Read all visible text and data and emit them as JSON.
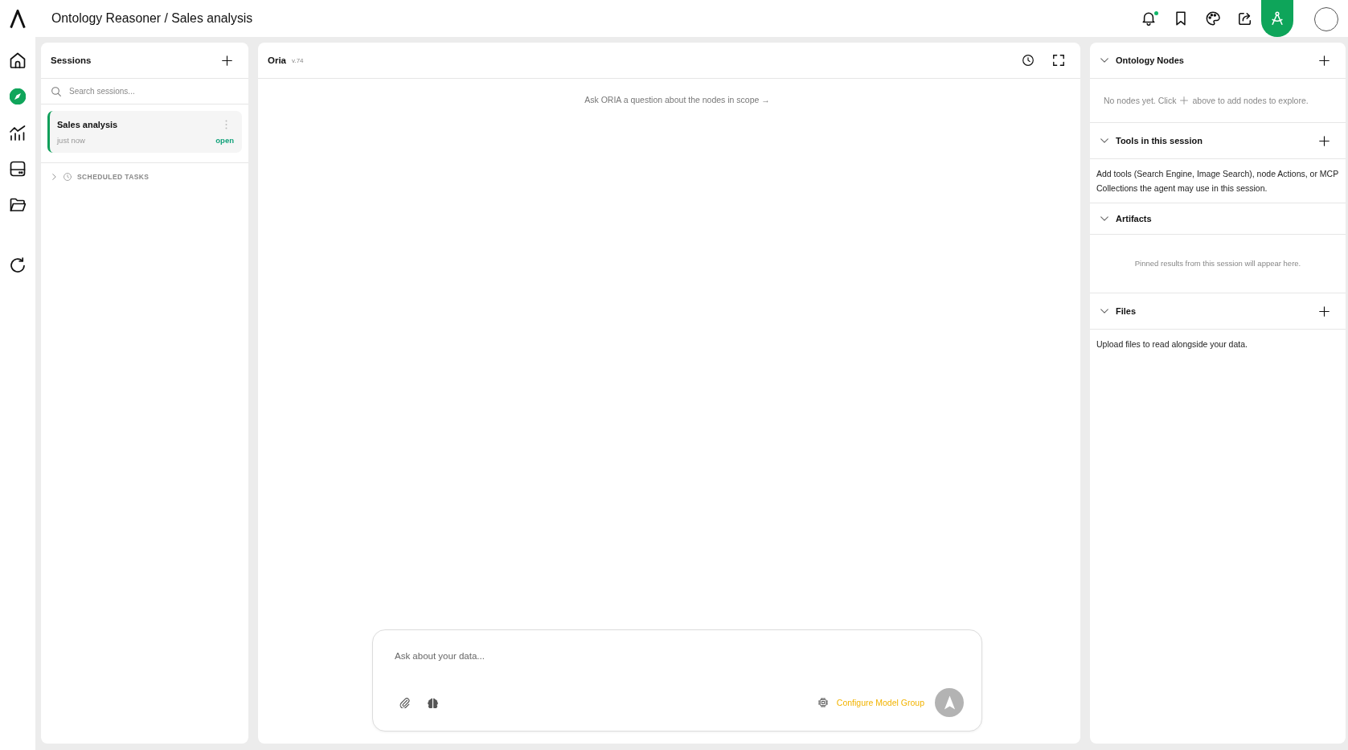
{
  "header": {
    "breadcrumb": "Ontology Reasoner / Sales analysis"
  },
  "top_actions": [
    {
      "kind": "bell",
      "unread": true,
      "selected": false
    },
    {
      "kind": "bookmark",
      "unread": false,
      "selected": false
    },
    {
      "kind": "palette",
      "unread": false,
      "selected": false
    },
    {
      "kind": "share",
      "unread": false,
      "selected": false
    },
    {
      "kind": "compass",
      "unread": false,
      "selected": true
    }
  ],
  "nav": [
    {
      "kind": "home",
      "selected": false
    },
    {
      "kind": "explore",
      "selected": true
    },
    {
      "kind": "chart",
      "selected": false
    },
    {
      "kind": "storage",
      "selected": false
    },
    {
      "kind": "folder",
      "selected": false
    }
  ],
  "sessions": {
    "title": "Sessions",
    "search": {
      "placeholder": "Search sessions..."
    },
    "items": [
      {
        "name": "Sales analysis",
        "time": "just now",
        "status": "open",
        "selected": true
      }
    ],
    "scheduled_tasks": {
      "label": "SCHEDULED TASKS",
      "expanded": false
    }
  },
  "chat": {
    "title": "Oria",
    "version": "v.74",
    "hint": "Ask ORIA a question about the nodes in scope →",
    "composer": {
      "placeholder": "Ask about your data...",
      "model_link": "Configure Model Group"
    }
  },
  "inspector": {
    "sections": [
      {
        "title": "Ontology Nodes",
        "expanded": true,
        "can_add": true,
        "body": {
          "kind": "inline_add_hint",
          "before": "No nodes yet. Click",
          "after": "above to add nodes to explore."
        }
      },
      {
        "title": "Tools in this session",
        "expanded": true,
        "can_add": true,
        "body": {
          "kind": "text",
          "text": "Add tools (Search Engine, Image Search), node Actions, or MCP Collections the agent may use in this session."
        }
      },
      {
        "title": "Artifacts",
        "expanded": true,
        "can_add": false,
        "body": {
          "kind": "placeholder",
          "text": "Pinned results from this session will appear here."
        }
      },
      {
        "title": "Files",
        "expanded": true,
        "can_add": true,
        "body": {
          "kind": "text",
          "text": "Upload files to read alongside your data."
        }
      }
    ]
  }
}
